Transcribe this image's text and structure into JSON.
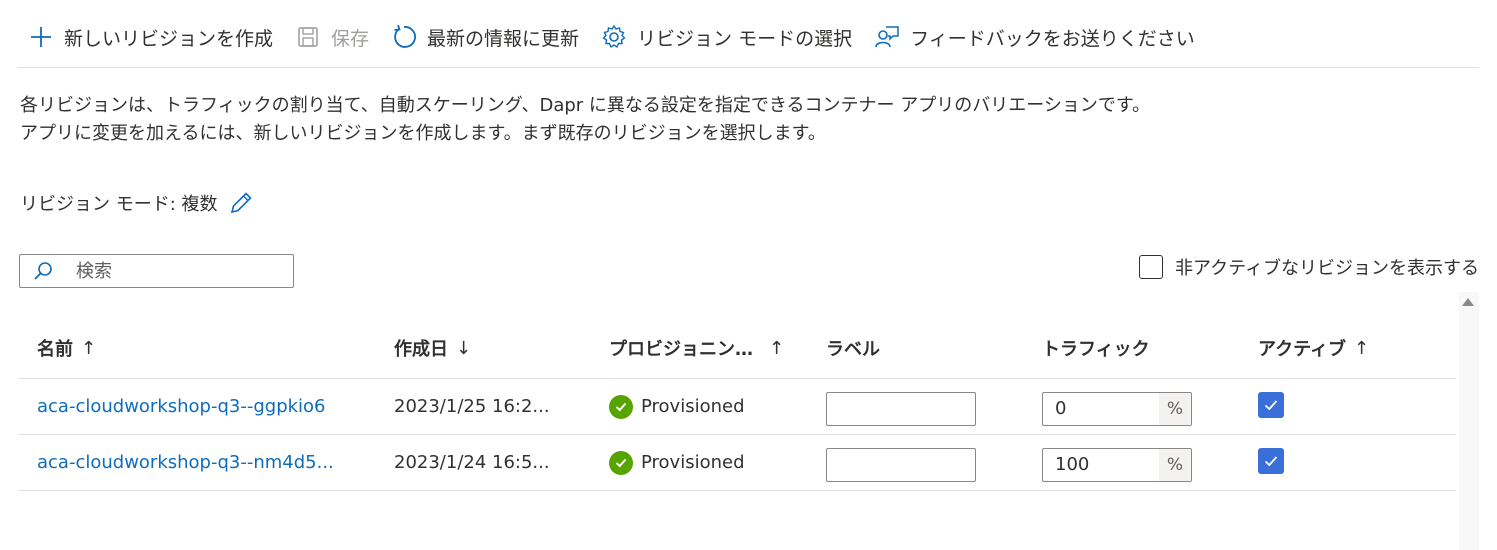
{
  "toolbar": {
    "new_revision": "新しいリビジョンを作成",
    "save": "保存",
    "refresh": "最新の情報に更新",
    "revision_mode": "リビジョン モードの選択",
    "feedback": "フィードバックをお送りください"
  },
  "description": {
    "line1": "各リビジョンは、トラフィックの割り当て、自動スケーリング、Dapr に異なる設定を指定できるコンテナー アプリのバリエーションです。",
    "line2": "アプリに変更を加えるには、新しいリビジョンを作成します。まず既存のリビジョンを選択します。"
  },
  "revision_mode": {
    "label": "リビジョン モード: 複数"
  },
  "search": {
    "placeholder": "検索",
    "value": ""
  },
  "show_inactive": {
    "label": "非アクティブなリビジョンを表示する",
    "checked": false
  },
  "table": {
    "columns": {
      "name": "名前",
      "name_sort": "↑",
      "created": "作成日",
      "created_sort": "↓",
      "provisioning": "プロビジョニン…",
      "provisioning_sort": "↑",
      "label": "ラベル",
      "traffic": "トラフィック",
      "active": "アクティブ",
      "active_sort": "↑"
    },
    "rows": [
      {
        "name": "aca-cloudworkshop-q3--ggpkio6",
        "created": "2023/1/25 16:2...",
        "status": "Provisioned",
        "label": "",
        "traffic": "0",
        "traffic_unit": "%",
        "active": true
      },
      {
        "name": "aca-cloudworkshop-q3--nm4d5...",
        "created": "2023/1/24 16:5...",
        "status": "Provisioned",
        "label": "",
        "traffic": "100",
        "traffic_unit": "%",
        "active": true
      }
    ]
  },
  "colors": {
    "link": "#0f6cbd",
    "status_ok": "#57a300",
    "checkbox_checked": "#3a6ed8",
    "icon_accent": "#0f6cbd"
  }
}
